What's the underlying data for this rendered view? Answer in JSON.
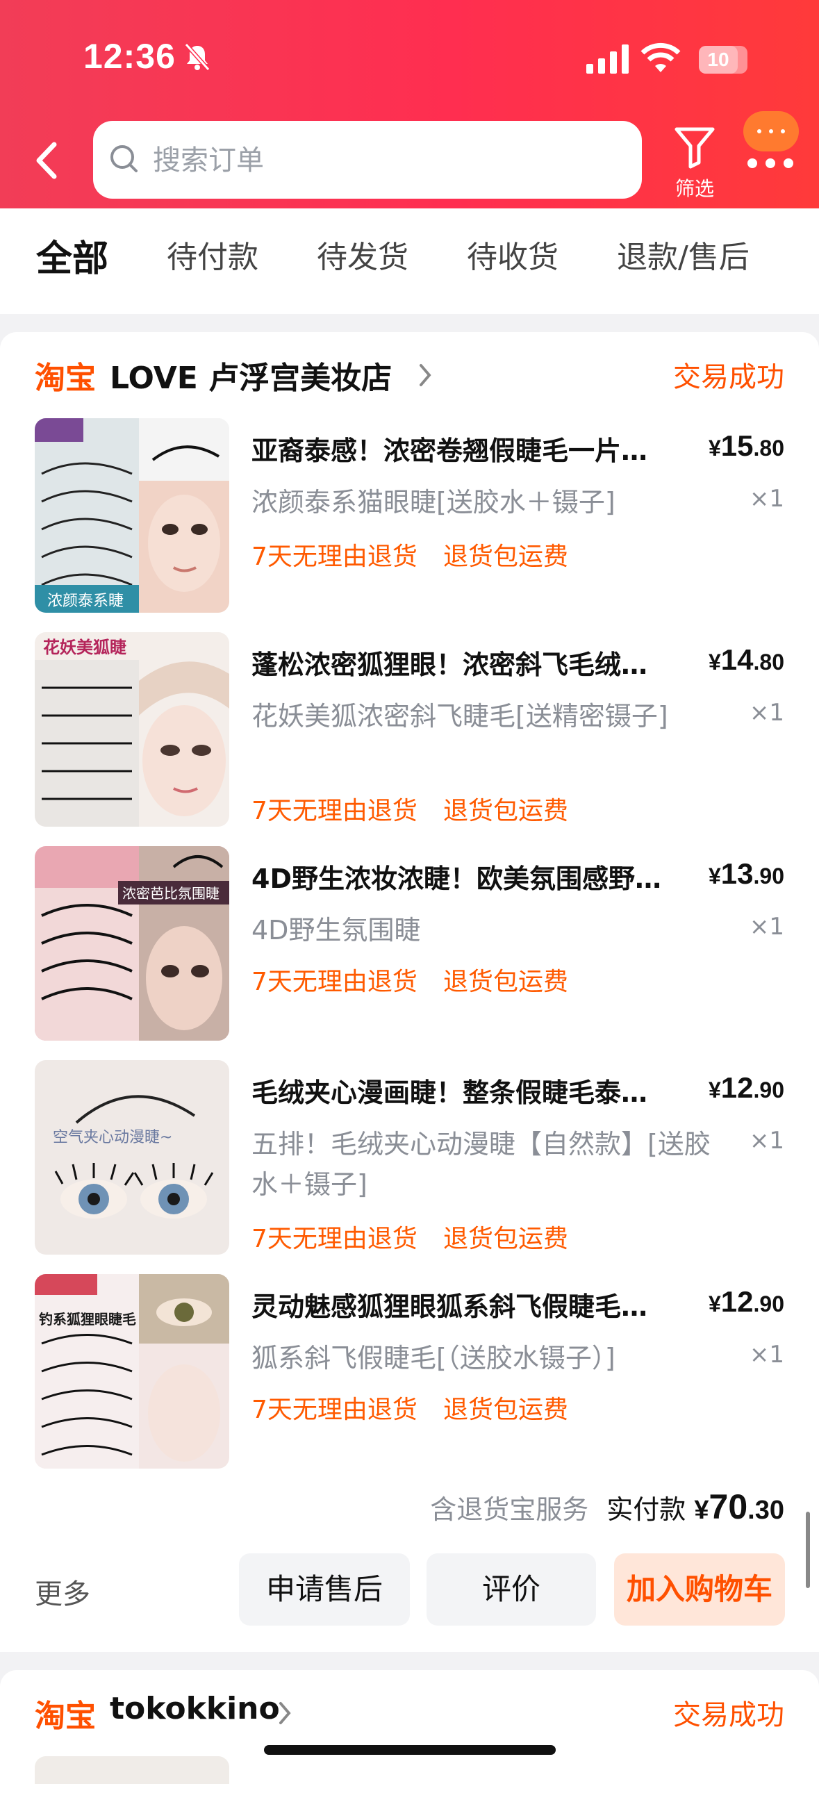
{
  "status_bar": {
    "time": "12:36",
    "battery": "10"
  },
  "search": {
    "placeholder": "搜索订单"
  },
  "header": {
    "filter_label": "筛选"
  },
  "tabs": [
    {
      "label": "全部",
      "active": true
    },
    {
      "label": "待付款"
    },
    {
      "label": "待发货"
    },
    {
      "label": "待收货"
    },
    {
      "label": "退款/售后"
    }
  ],
  "orders": [
    {
      "platform": "淘宝",
      "shop": "LOVE 卢浮宫美妆店",
      "status": "交易成功",
      "items": [
        {
          "title": "亚裔泰感！浓密卷翘假睫毛一片…",
          "price_int": "15",
          "price_dec": ".80",
          "spec": "浓颜泰系猫眼睫[送胶水＋镊子]",
          "qty": "×1",
          "thumb_text": "浓颜泰系睫",
          "tags": [
            "7天无理由退货",
            "退货包运费"
          ]
        },
        {
          "title": "蓬松浓密狐狸眼！浓密斜飞毛绒…",
          "price_int": "14",
          "price_dec": ".80",
          "spec": "花妖美狐浓密斜飞睫毛[送精密镊子]",
          "qty": "×1",
          "thumb_text": "花妖美狐睫",
          "tags": [
            "7天无理由退货",
            "退货包运费"
          ]
        },
        {
          "title": "4D野生浓妆浓睫！欧美氛围感野…",
          "price_int": "13",
          "price_dec": ".90",
          "spec": "4D野生氛围睫",
          "qty": "×1",
          "thumb_text": "浓密芭比氛围睫",
          "tags": [
            "7天无理由退货",
            "退货包运费"
          ]
        },
        {
          "title": "毛绒夹心漫画睫！整条假睫毛泰…",
          "price_int": "12",
          "price_dec": ".90",
          "spec": "五排！毛绒夹心动漫睫【自然款】[送胶水＋镊子]",
          "qty": "×1",
          "thumb_text": "空气夹心动漫睫~",
          "tags": [
            "7天无理由退货",
            "退货包运费"
          ]
        },
        {
          "title": "灵动魅感狐狸眼狐系斜飞假睫毛…",
          "price_int": "12",
          "price_dec": ".90",
          "spec": "狐系斜飞假睫毛[（送胶水镊子）]",
          "qty": "×1",
          "thumb_text": "钓系狐狸眼睫毛",
          "tags": [
            "7天无理由退货",
            "退货包运费"
          ]
        }
      ],
      "summary": {
        "service": "含退货宝服务",
        "paid_label": "实付款",
        "currency": "¥",
        "total_int": "70",
        "total_dec": ".30"
      },
      "actions": {
        "more": "更多",
        "after_sale": "申请售后",
        "review": "评价",
        "add_cart": "加入购物车"
      }
    },
    {
      "platform": "淘宝",
      "shop": "tokokkino",
      "status": "交易成功"
    }
  ],
  "colors": {
    "header_red": "#ff2e50",
    "accent_orange": "#ff5000",
    "tag_orange": "#ff5a00"
  }
}
